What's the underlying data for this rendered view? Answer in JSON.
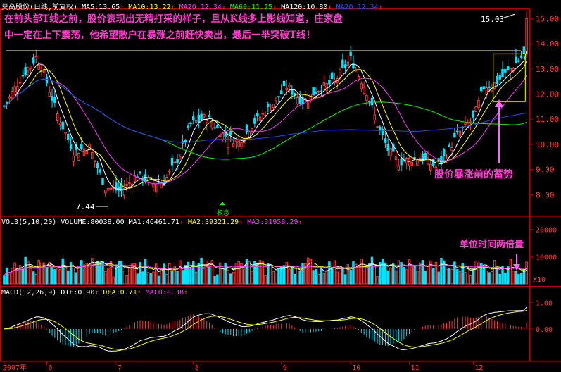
{
  "colors": {
    "up": "#ff3b3b",
    "down": "#00e5ff",
    "ma5": "#ffffff",
    "ma10": "#ffff00",
    "ma20": "#ff33ff",
    "ma60": "#00ff00",
    "ma120": "#2244ff",
    "axis": "#c00000",
    "annotation": "#ff3ccf",
    "box": "#ffff00",
    "arrow": "#ff66ff"
  },
  "price_header": {
    "stock": "莫高股份(日线,前复权)",
    "ma5": "MA5:13.65",
    "ma10": "MA10:13.22",
    "ma20": "MA20:12.34",
    "ma60": "MA60:11.25",
    "ma120": "MA120:10.80",
    "ma20b": "MA20:12.34"
  },
  "volume_header": {
    "title": "VOL3(5,10,20) VOLUME:80038.00",
    "ma1": "MA1:46461.71",
    "ma2": "MA2:39321.29",
    "ma3": "MA3:31958.29"
  },
  "macd_header": {
    "title": "MACD(12,26,9)",
    "dif": "DIF:0.90",
    "dea": "DEA:0.71",
    "macd": "MACD:0.38"
  },
  "annotations": {
    "line1": "在前头部T线之前，股价表现出无精打采的样子，且从K线多上影线知道，庄家盘",
    "line2": "中一定在上下震荡，他希望散户在暴涨之前赶快卖出，最后一举突破T线！",
    "accumulation": "股价暴涨前的蓄势",
    "volume_double": "单位时间两倍量",
    "low_price": "7.44",
    "high_price": "15.03",
    "split": "权息"
  },
  "chart_data": [
    {
      "type": "candlestick",
      "title": "莫高股份(日线,前复权)",
      "y_ticks": [
        "15.00",
        "14.00",
        "13.00",
        "12.00",
        "11.00",
        "10.00",
        "9.00",
        "8.00"
      ],
      "ylim": [
        7.2,
        15.4
      ],
      "t_line": 13.72,
      "accumulation_box": {
        "start_bar": 184,
        "end_bar": 195,
        "low": 11.7,
        "high": 13.6
      },
      "x_labels": [
        {
          "label": "2007年",
          "bar": 0
        },
        {
          "label": "6",
          "bar": 16
        },
        {
          "label": "7",
          "bar": 42
        },
        {
          "label": "8",
          "bar": 71
        },
        {
          "label": "9",
          "bar": 104
        },
        {
          "label": "10",
          "bar": 130
        },
        {
          "label": "11",
          "bar": 152
        },
        {
          "label": "12",
          "bar": 176
        }
      ],
      "bars": 197,
      "close_keypoints": [
        [
          0,
          11.5
        ],
        [
          6,
          12.6
        ],
        [
          12,
          13.45
        ],
        [
          14,
          13.1
        ],
        [
          20,
          11.2
        ],
        [
          26,
          9.7
        ],
        [
          32,
          9.9
        ],
        [
          38,
          8.3
        ],
        [
          44,
          8.15
        ],
        [
          50,
          8.8
        ],
        [
          56,
          8.45
        ],
        [
          60,
          8.5
        ],
        [
          66,
          9.6
        ],
        [
          70,
          10.8
        ],
        [
          76,
          11.1
        ],
        [
          82,
          10.4
        ],
        [
          88,
          10.1
        ],
        [
          94,
          10.9
        ],
        [
          100,
          11.5
        ],
        [
          106,
          12.3
        ],
        [
          112,
          11.7
        ],
        [
          118,
          12.2
        ],
        [
          124,
          12.5
        ],
        [
          130,
          13.4
        ],
        [
          136,
          12.1
        ],
        [
          140,
          10.8
        ],
        [
          144,
          9.8
        ],
        [
          148,
          9.3
        ],
        [
          156,
          9.5
        ],
        [
          162,
          9.1
        ],
        [
          166,
          9.6
        ],
        [
          170,
          10.4
        ],
        [
          176,
          11.0
        ],
        [
          180,
          12.3
        ],
        [
          184,
          12.4
        ],
        [
          190,
          13.0
        ],
        [
          195,
          13.55
        ],
        [
          196,
          15.0
        ]
      ],
      "series": [
        {
          "name": "MA5",
          "last": 13.65
        },
        {
          "name": "MA10",
          "last": 13.22
        },
        {
          "name": "MA20",
          "last": 12.34
        },
        {
          "name": "MA60",
          "last": 11.25
        },
        {
          "name": "MA120",
          "last": 10.8
        }
      ]
    },
    {
      "type": "bar",
      "title": "VOL3(5,10,20)",
      "y_ticks": [
        "20000",
        "10000"
      ],
      "unit": "X10",
      "ylim": [
        0,
        22000
      ],
      "last": {
        "VOLUME": 80038.0,
        "MA1": 46461.71,
        "MA2": 39321.29,
        "MA3": 31958.29
      }
    },
    {
      "type": "bar",
      "title": "MACD(12,26,9)",
      "y_ticks": [
        "1.00",
        "0.00"
      ],
      "ylim": [
        -1.2,
        1.3
      ],
      "last": {
        "DIF": 0.9,
        "DEA": 0.71,
        "MACD": 0.38
      }
    }
  ]
}
